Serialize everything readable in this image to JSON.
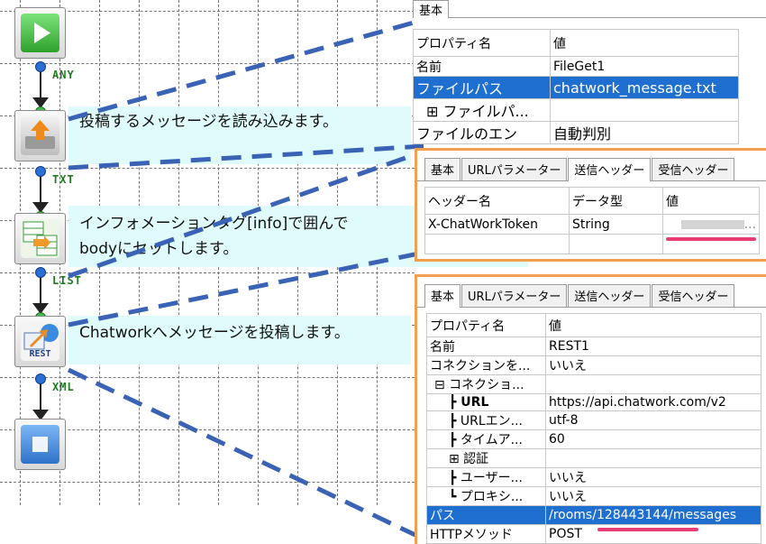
{
  "flow": {
    "ports": [
      "ANY",
      "TXT",
      "LIST",
      "XML"
    ],
    "icons": [
      "start-icon",
      "file-get-icon",
      "mapper-icon",
      "rest-icon",
      "end-icon"
    ],
    "rest_badge": "REST"
  },
  "notes": {
    "note1": "投稿するメッセージを読み込みます。",
    "note2_line1": "インフォメーションタグ[info]で囲んで",
    "note2_line2": "bodyにセットします。",
    "note3": "Chatworkへメッセージを投稿します。"
  },
  "panel1": {
    "tab": "基本",
    "header": [
      "プロパティ名",
      "値"
    ],
    "rows": [
      [
        "名前",
        "FileGet1"
      ],
      [
        "ファイルパス",
        "chatwork_message.txt"
      ],
      [
        "⊞ ファイルパ...",
        ""
      ],
      [
        "ファイルのエン",
        "自動判別"
      ]
    ]
  },
  "panel2": {
    "tabs": [
      "基本",
      "URLパラメーター",
      "送信ヘッダー",
      "受信ヘッダー"
    ],
    "header": [
      "ヘッダー名",
      "データ型",
      "値"
    ],
    "rows": [
      [
        "X-ChatWorkToken",
        "String",
        "..."
      ]
    ]
  },
  "panel3": {
    "tabs": [
      "基本",
      "URLパラメーター",
      "送信ヘッダー",
      "受信ヘッダー"
    ],
    "header": [
      "プロパティ名",
      "値"
    ],
    "rows": [
      [
        "名前",
        "REST1"
      ],
      [
        "コネクションを...",
        "いいえ"
      ],
      [
        "⊟ コネクショ...",
        ""
      ],
      [
        "┣ URL",
        "https://api.chatwork.com/v2"
      ],
      [
        "┣ URLエン...",
        "utf-8"
      ],
      [
        "┣ タイムア...",
        "60"
      ],
      [
        "⊞ 認証",
        ""
      ],
      [
        "┣ ユーザー...",
        "いいえ"
      ],
      [
        "┗ プロキシ...",
        "いいえ"
      ],
      [
        "パス",
        "/rooms/128443144/messages"
      ],
      [
        "HTTPメソッド",
        "POST"
      ]
    ]
  },
  "colors": {
    "selection": "#1f6fd1",
    "note_bg": "#dffbfc",
    "dash": "#3a63b5",
    "underline": "#e83c73",
    "frame": "#f0a050"
  }
}
